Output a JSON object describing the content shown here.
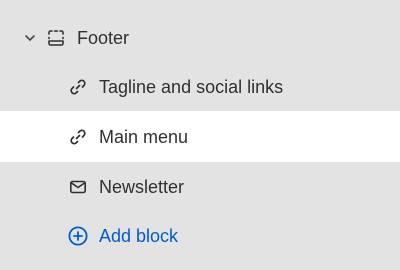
{
  "section": {
    "label": "Footer",
    "icon": "footer-section-icon",
    "expanded": true
  },
  "blocks": [
    {
      "label": "Tagline and social links",
      "icon": "link-icon",
      "selected": false
    },
    {
      "label": "Main menu",
      "icon": "link-icon",
      "selected": true
    },
    {
      "label": "Newsletter",
      "icon": "email-icon",
      "selected": false
    }
  ],
  "add_block": {
    "label": "Add block",
    "icon": "plus-circle-icon"
  },
  "colors": {
    "background": "#e3e3e3",
    "selected_row": "#ffffff",
    "text": "#303030",
    "accent": "#005bd3"
  }
}
